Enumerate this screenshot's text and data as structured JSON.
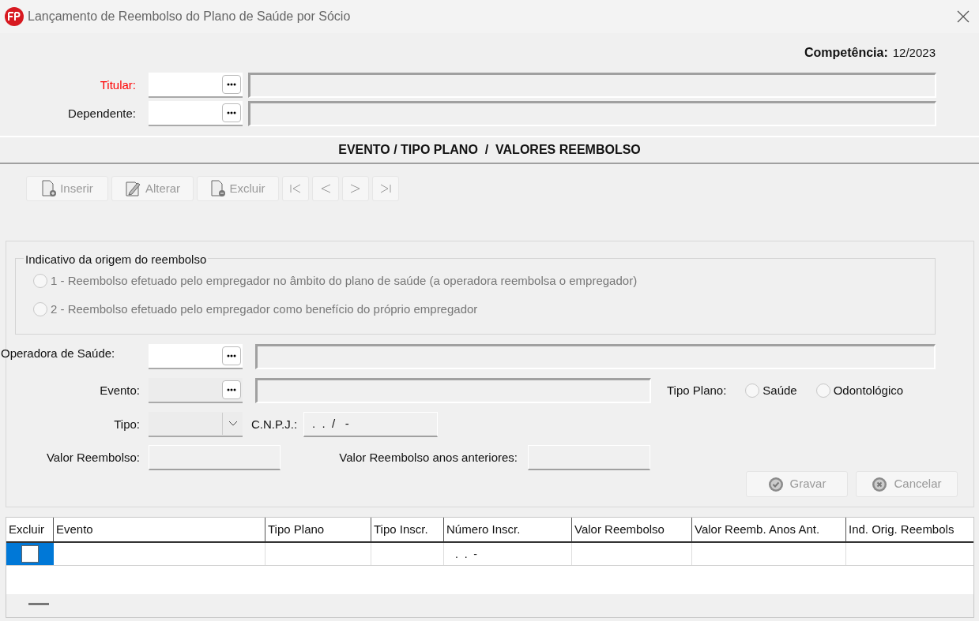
{
  "window": {
    "title": "Lançamento de Reembolso do Plano de Saúde por Sócio"
  },
  "competencia": {
    "label": "Competência:",
    "value": "12/2023"
  },
  "header_fields": [
    {
      "label": "Titular:",
      "required": true
    },
    {
      "label": "Dependente:",
      "required": false
    }
  ],
  "section_title": "EVENTO / TIPO PLANO  /  VALORES REEMBOLSO",
  "toolbar": [
    {
      "kind": "insert",
      "label": "Inserir",
      "disabled": true
    },
    {
      "kind": "edit",
      "label": "Alterar",
      "disabled": true
    },
    {
      "kind": "delete",
      "label": "Excluir",
      "disabled": true
    },
    {
      "kind": "first",
      "disabled": true
    },
    {
      "kind": "prev",
      "disabled": true
    },
    {
      "kind": "next",
      "disabled": true
    },
    {
      "kind": "last",
      "disabled": true
    }
  ],
  "origin_group": {
    "title": "Indicativo da origem do reembolso",
    "options": [
      {
        "label": "1 - Reembolso efetuado pelo empregador no âmbito do plano de saúde (a operadora reembolsa o empregador)",
        "selected": false,
        "disabled": true
      },
      {
        "label": "2 - Reembolso efetuado pelo empregador como benefício do próprio empregador",
        "selected": false,
        "disabled": true
      }
    ]
  },
  "operadora": {
    "label": "Operadora de Saúde:"
  },
  "evento": {
    "label": "Evento:"
  },
  "tipo_plano": {
    "label": "Tipo Plano:",
    "options": [
      {
        "label": "Saúde",
        "selected": false
      },
      {
        "label": "Odontológico",
        "selected": false
      }
    ]
  },
  "tipo": {
    "label": "Tipo:"
  },
  "cnpj": {
    "label": "C.N.P.J.:",
    "value": ".  .  /   -"
  },
  "valor_reembolso": {
    "label": "Valor Reembolso:"
  },
  "valor_anteriores": {
    "label": "Valor Reembolso anos anteriores:"
  },
  "actions": [
    {
      "kind": "save",
      "label": "Gravar",
      "disabled": true
    },
    {
      "kind": "cancel",
      "label": "Cancelar",
      "disabled": true
    }
  ],
  "table": {
    "columns": [
      "Excluir",
      "Evento",
      "Tipo Plano",
      "Tipo Inscr.",
      "Número Inscr.",
      "Valor Reembolso",
      "Valor Reemb. Anos Ant.",
      "Ind. Orig. Reembols"
    ],
    "rows": [
      {
        "selected": true,
        "excluir_checked": false,
        "numero_inscr": ".  .  -"
      }
    ]
  }
}
